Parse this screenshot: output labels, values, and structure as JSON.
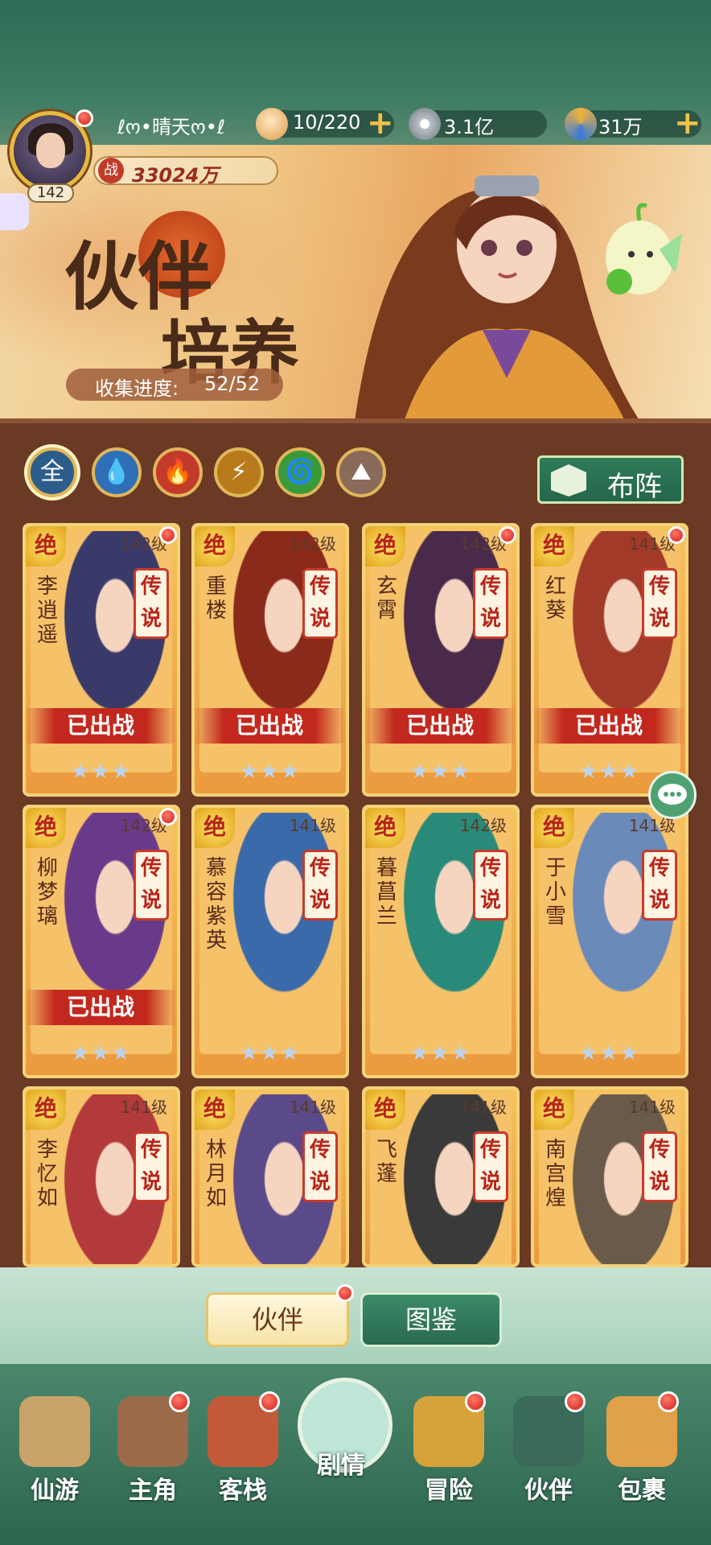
{
  "player": {
    "name": "ℓო•晴天ო•ℓ",
    "level": "142",
    "power_label": "战",
    "power_value": "33024万"
  },
  "resources": [
    {
      "icon": "bun-icon",
      "value": "10/220",
      "has_plus": true
    },
    {
      "icon": "coin-icon",
      "value": "3.1亿",
      "has_plus": false
    },
    {
      "icon": "swirl-icon",
      "value": "31万",
      "has_plus": true
    }
  ],
  "banner": {
    "title_line1": "伙伴",
    "title_line2": "培养",
    "collect_label": "收集进度:",
    "collect_value": "52/52"
  },
  "filters": [
    {
      "label": "全",
      "icon": "all-icon",
      "color": "#2c5d8a",
      "selected": true
    },
    {
      "label": "",
      "icon": "water-icon",
      "color": "#2f6fb8"
    },
    {
      "label": "",
      "icon": "fire-icon",
      "color": "#c23a2a"
    },
    {
      "label": "",
      "icon": "thunder-icon",
      "color": "#b87a1a"
    },
    {
      "label": "",
      "icon": "wind-icon",
      "color": "#3a9a3a"
    },
    {
      "label": "",
      "icon": "earth-icon",
      "color": "#8a6a5a"
    }
  ],
  "formation_label": "布阵",
  "cards": [
    {
      "tier": "绝",
      "level": "142级",
      "name": "李逍遥",
      "rarity": "传说",
      "deployed": "已出战",
      "dot": true,
      "hue": "#3a3a6a"
    },
    {
      "tier": "绝",
      "level": "142级",
      "name": "重楼",
      "rarity": "传说",
      "deployed": "已出战",
      "dot": false,
      "hue": "#8a2a1a"
    },
    {
      "tier": "绝",
      "level": "142级",
      "name": "玄霄",
      "rarity": "传说",
      "deployed": "已出战",
      "dot": true,
      "hue": "#4a2a4a"
    },
    {
      "tier": "绝",
      "level": "141级",
      "name": "红葵",
      "rarity": "传说",
      "deployed": "已出战",
      "dot": true,
      "hue": "#a23a2a"
    },
    {
      "tier": "绝",
      "level": "142级",
      "name": "柳梦璃",
      "rarity": "传说",
      "deployed": "已出战",
      "dot": true,
      "hue": "#6a3a8a"
    },
    {
      "tier": "绝",
      "level": "141级",
      "name": "慕容紫英",
      "rarity": "传说",
      "deployed": "",
      "dot": false,
      "hue": "#3a6aaa"
    },
    {
      "tier": "绝",
      "level": "142级",
      "name": "暮菖兰",
      "rarity": "传说",
      "deployed": "",
      "dot": false,
      "hue": "#2a8a7a"
    },
    {
      "tier": "绝",
      "level": "141级",
      "name": "于小雪",
      "rarity": "传说",
      "deployed": "",
      "dot": false,
      "hue": "#6a8aba"
    },
    {
      "tier": "绝",
      "level": "141级",
      "name": "李忆如",
      "rarity": "传说",
      "deployed": "",
      "dot": false,
      "hue": "#b23a3a"
    },
    {
      "tier": "绝",
      "level": "141级",
      "name": "林月如",
      "rarity": "传说",
      "deployed": "",
      "dot": false,
      "hue": "#5a4a8a"
    },
    {
      "tier": "绝",
      "level": "141级",
      "name": "飞蓬",
      "rarity": "传说",
      "deployed": "",
      "dot": false,
      "hue": "#3a3a3a"
    },
    {
      "tier": "绝",
      "level": "141级",
      "name": "南宫煌",
      "rarity": "传说",
      "deployed": "",
      "dot": false,
      "hue": "#6a5a4a"
    }
  ],
  "sub_tabs": [
    {
      "label": "伙伴",
      "active": true
    },
    {
      "label": "图鉴",
      "active": false
    }
  ],
  "nav": [
    {
      "label": "仙游",
      "icon": "book-icon",
      "dot": false
    },
    {
      "label": "主角",
      "icon": "hero-icon",
      "dot": true
    },
    {
      "label": "客栈",
      "icon": "inn-icon",
      "dot": true
    },
    {
      "label": "剧情",
      "icon": "story-icon",
      "dot": false
    },
    {
      "label": "冒险",
      "icon": "gourd-icon",
      "dot": true
    },
    {
      "label": "伙伴",
      "icon": "partner-icon",
      "dot": true
    },
    {
      "label": "包裹",
      "icon": "bag-icon",
      "dot": true
    }
  ]
}
